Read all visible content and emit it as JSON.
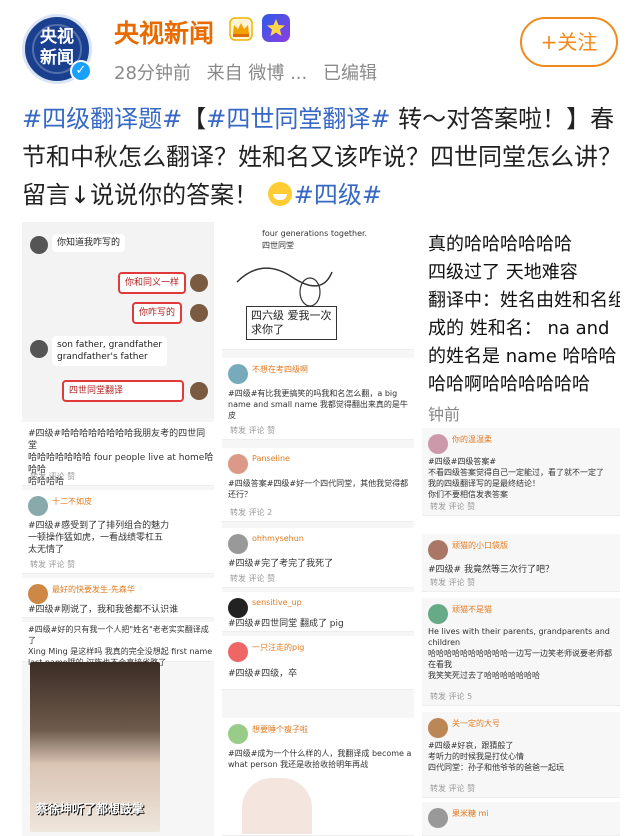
{
  "header": {
    "account_name": "央视新闻",
    "avatar_text": "央视\n新闻",
    "time": "28分钟前",
    "source": "来自 微博 ...",
    "edited": "已编辑",
    "follow_label": "+关注"
  },
  "post": {
    "tag1": "#四级翻译题#",
    "bracket_open": "【",
    "tag2": "#四世同堂翻译#",
    "text1": " 转～对答案啦！】春节和中秋怎么翻译？姓和名又该咋说？四世同堂怎么讲？留言↓说说你的答案！",
    "tag3": "#四级#"
  },
  "collage": {
    "col1": {
      "chat_bubbles": [
        "你知道我咋写的",
        "你和同义一样",
        "你咋写的",
        "son father, grandfather\ngrandfather's father",
        "四世同堂翻译"
      ],
      "comments": [
        {
          "text": "#四级#哈哈哈哈哈哈哈哈我朋友考的四世同堂\n哈哈哈哈哈哈哈 four people live at home哈哈哈\n哈哈哈哈",
          "bar": "转发     评论     赞"
        },
        {
          "user": "十二不如皮",
          "text": "#四级#感受到了了排列组合的魅力\n一顿操作猛如虎，一看战绩零杠五\n太无情了",
          "bar": "转发     评论     赞"
        },
        {
          "user": "最好的快要发生-先森华",
          "text": "#四级#刚说了，我和我爸都不认识谁",
          "bar": ""
        },
        {
          "text": "#四级#好的只有我一个人把\"姓名\"老老实实翻译成了\nXing Ming 是这样吗 我真的完全没想起 first name\nlast name哦的 汉族也不会直接省略了",
          "bar": ""
        }
      ],
      "photo_caption": "蔡徐坤听了都想鼓掌"
    },
    "col2": {
      "top_text": "four generations together.\n四世同堂",
      "comic_caption": "四六级  爱我一次\n求你了",
      "comments": [
        {
          "user": "不想在考四级啊",
          "text": "#四级#有比我更搞笑的吗我和名怎么翻，a big\nname and small name 我都觉得翻出来真的是牛皮",
          "bar": "转发     评论     赞"
        },
        {
          "user": "Panseline",
          "text": "#四级答案#四级#好一个四代同堂，其他我觉得都\n还行？",
          "bar": "转发     评论     2"
        },
        {
          "user": "ohhmysehun",
          "text": "#四级#完了考完了我死了",
          "bar": "转发     评论     赞"
        },
        {
          "user": "sensitive_up",
          "text": "#四级#四世同堂 翻成了 pig",
          "bar": ""
        },
        {
          "user": "一只汪走的pig",
          "text": "#四级#四级，卒",
          "bar": ""
        },
        {
          "user": "想要睡个瘦子啦",
          "text": "#四级#成为一个什么样的人，我翻译成 become a\nwhat person  我还是收拾收拾明年再战",
          "bar": ""
        }
      ]
    },
    "col3": {
      "big_lines": [
        "真的哈哈哈哈哈哈",
        "四级过了 天地难容",
        "翻译中：姓名由姓和名组",
        "成的 姓和名： na and",
        "的姓名是 name 哈哈哈",
        "哈哈啊哈哈哈哈哈哈"
      ],
      "time": "钟前",
      "comments": [
        {
          "user": "你的温温柔",
          "text": "#四级#四级答案#\n不看四级答案觉得自己一定能过，看了就不一定了\n我的四级翻译写的是最终结论！\n你们不要相信发表答案",
          "bar": "转发     评论     赞"
        },
        {
          "user": "顽猫的小口袋版",
          "text": "#四级# 我竟然等三次行了吧？",
          "bar": "转发     评论     赞"
        },
        {
          "user": "顽猫不是猫",
          "text": "He lives with their parents, grandparents and\nchildren\n哈哈哈哈哈哈哈哈哈哈一边写一边笑老师说要老师都\n在看我\n我笑笑死过去了哈哈哈哈哈哈哈",
          "bar": "转发     评论     5"
        },
        {
          "user": "关一定的大号",
          "text": "#四级#好哀，跟猜般了\n考听力的时候我是打仗心情\n四代同堂：孙子和他爷爷的爸爸一起玩",
          "bar": "转发     评论     赞"
        },
        {
          "user": "果米糖 mi",
          "text": "",
          "bar": ""
        }
      ]
    }
  }
}
